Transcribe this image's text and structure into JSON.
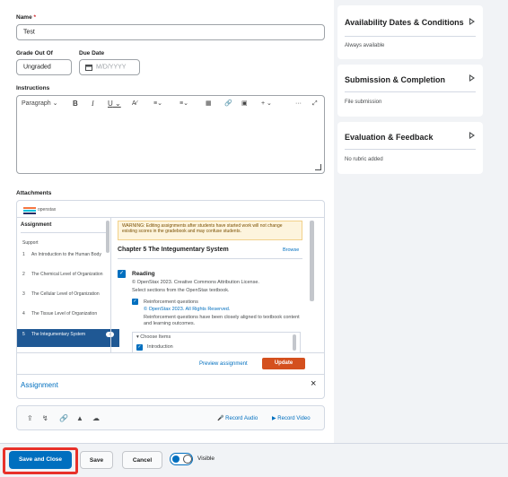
{
  "form": {
    "name_label": "Name",
    "name_required": "*",
    "name_value": "Test",
    "grade_label": "Grade Out Of",
    "grade_value": "Ungraded",
    "due_label": "Due Date",
    "due_placeholder": "M/D/YYYY",
    "instructions_label": "Instructions",
    "attachments_label": "Attachments"
  },
  "editor_toolbar": {
    "format": "Paragraph",
    "bold": "B",
    "italic": "I",
    "underline": "U",
    "more": "···"
  },
  "embed": {
    "logo_text": "openstax",
    "sidebar_title": "Assignment",
    "section_label": "Support",
    "chapters": [
      {
        "num": "1",
        "title": "An Introduction to the Human Body"
      },
      {
        "num": "2",
        "title": "The Chemical Level of Organization"
      },
      {
        "num": "3",
        "title": "The Cellular Level of Organization"
      },
      {
        "num": "4",
        "title": "The Tissue Level of Organization"
      },
      {
        "num": "5",
        "title": "The Integumentary System",
        "badge": "4"
      }
    ],
    "warning": "WARNING: Editing assignments after students have started work will not change existing scores in the gradebook and may confuse students.",
    "chapter_title": "Chapter 5 The Integumentary System",
    "browse": "Browse",
    "reading_title": "Reading",
    "reading_license": "© OpenStax 2023. Creative Commons Attribution License.",
    "reading_desc": "Select sections from the OpenStax textbook.",
    "reinf_title": "Reinforcement questions",
    "reinf_license": "© OpenStax 2023. All Rights Reserved.",
    "reinf_desc": "Reinforcement questions have been closely aligned to textbook content and learning outcomes.",
    "choose_items": "Choose Items",
    "intro_item": "Introduction",
    "preview_btn": "Preview assignment",
    "update_btn": "Update",
    "item_link": "Assignment",
    "close": "×"
  },
  "attach_bar": {
    "record_audio": "Record Audio",
    "record_video": "Record Video"
  },
  "side_cards": [
    {
      "title": "Availability Dates & Conditions",
      "sub": "Always available"
    },
    {
      "title": "Submission & Completion",
      "sub": "File submission"
    },
    {
      "title": "Evaluation & Feedback",
      "sub": "No rubric added"
    }
  ],
  "footer": {
    "save_close": "Save and Close",
    "save": "Save",
    "cancel": "Cancel",
    "visible": "Visible"
  },
  "colors": {
    "primary": "#006fbf",
    "highlight_border": "#e8312a",
    "update": "#d4501e",
    "warning_bg": "#fdf4dd",
    "selected_chapter": "#1f5894"
  }
}
